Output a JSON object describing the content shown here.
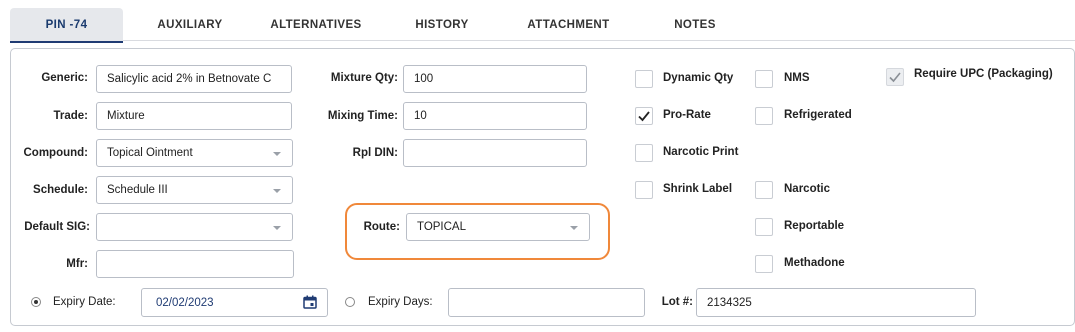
{
  "tabs": [
    {
      "label": "PIN -74"
    },
    {
      "label": "AUXILIARY"
    },
    {
      "label": "ALTERNATIVES"
    },
    {
      "label": "HISTORY"
    },
    {
      "label": "ATTACHMENT"
    },
    {
      "label": "NOTES"
    }
  ],
  "fields": {
    "generic": {
      "label": "Generic:",
      "value": "Salicylic acid 2% in Betnovate C"
    },
    "trade": {
      "label": "Trade:",
      "value": "Mixture"
    },
    "compound": {
      "label": "Compound:",
      "value": "Topical Ointment"
    },
    "schedule": {
      "label": "Schedule:",
      "value": "Schedule III"
    },
    "default_sig": {
      "label": "Default SIG:",
      "value": ""
    },
    "mfr": {
      "label": "Mfr:",
      "value": ""
    },
    "mixture_qty": {
      "label": "Mixture Qty:",
      "value": "100"
    },
    "mixing_time": {
      "label": "Mixing Time:",
      "value": "10"
    },
    "rpl_din": {
      "label": "Rpl DIN:",
      "value": ""
    },
    "route": {
      "label": "Route:",
      "value": "TOPICAL"
    },
    "expiry_date": {
      "label": "Expiry Date:",
      "value": "02/02/2023"
    },
    "expiry_days": {
      "label": "Expiry Days:",
      "value": ""
    },
    "lot": {
      "label": "Lot #:",
      "value": "2134325"
    }
  },
  "checkboxes": {
    "dynamic_qty": {
      "label": "Dynamic Qty",
      "checked": false
    },
    "pro_rate": {
      "label": "Pro-Rate",
      "checked": true
    },
    "narcotic_print": {
      "label": "Narcotic Print",
      "checked": false
    },
    "shrink_label": {
      "label": "Shrink Label",
      "checked": false
    },
    "nms": {
      "label": "NMS",
      "checked": false
    },
    "refrigerated": {
      "label": "Refrigerated",
      "checked": false
    },
    "narcotic": {
      "label": "Narcotic",
      "checked": false
    },
    "reportable": {
      "label": "Reportable",
      "checked": false
    },
    "methadone": {
      "label": "Methadone",
      "checked": false
    },
    "require_upc": {
      "label": "Require UPC (Packaging)",
      "checked": true,
      "disabled": true
    }
  },
  "expiry_mode_selected": "expiry_date",
  "colors": {
    "accent": "#1f3b73",
    "highlight": "#f0883a"
  }
}
